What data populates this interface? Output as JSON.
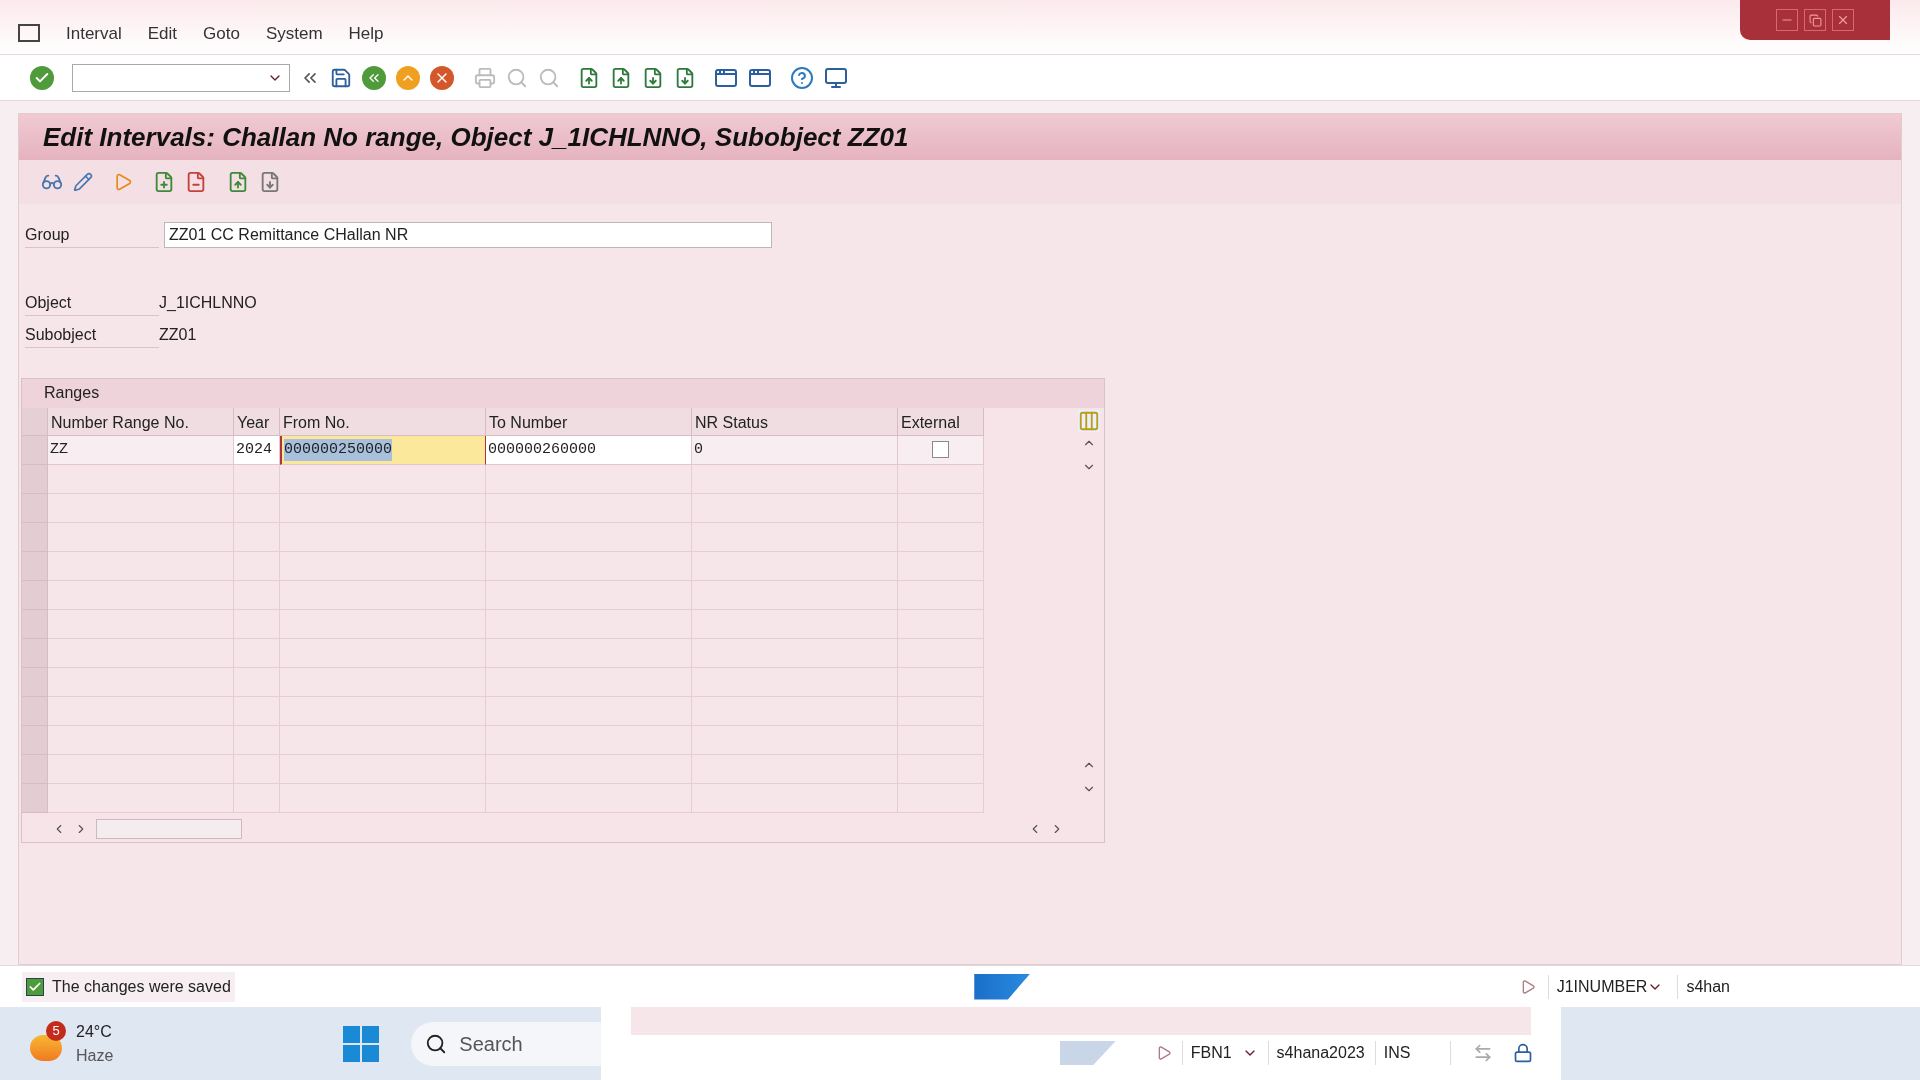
{
  "menu": [
    {
      "label": "Interval"
    },
    {
      "label": "Edit"
    },
    {
      "label": "Goto"
    },
    {
      "label": "System"
    },
    {
      "label": "Help"
    }
  ],
  "title": "Edit Intervals: Challan No range, Object J_1ICHLNNO, Subobject ZZ01",
  "fields": [
    {
      "label": "Group",
      "value": "ZZ01 CC Remittance CHallan NR",
      "kind": "input"
    },
    {
      "label": "Object",
      "value": "J_1ICHLNNO",
      "kind": "text"
    },
    {
      "label": "Subobject",
      "value": "ZZ01",
      "kind": "text"
    }
  ],
  "ranges": {
    "title": "Ranges",
    "columns": [
      "Number Range No.",
      "Year",
      "From No.",
      "To Number",
      "NR Status",
      "External"
    ],
    "rows": [
      {
        "cells": [
          {
            "kind": "text",
            "text": "ZZ",
            "selected": false
          },
          {
            "kind": "input",
            "text": "2024",
            "selected": false
          },
          {
            "kind": "input",
            "text": "000000250000",
            "selected": true
          },
          {
            "kind": "input",
            "text": "000000260000",
            "selected": false
          },
          {
            "kind": "text",
            "text": "0",
            "selected": false
          },
          {
            "kind": "checkbox",
            "checked": false
          }
        ]
      }
    ]
  },
  "status_bar": {
    "message": "The changes were saved",
    "transaction": "J1INUMBER",
    "system": "s4han"
  },
  "background_window": {
    "transaction": "FBN1",
    "system": "s4hana2023",
    "mode": "INS"
  },
  "taskbar": {
    "temperature": "24°C",
    "condition": "Haze",
    "badge": "5",
    "search_placeholder": "Search"
  }
}
